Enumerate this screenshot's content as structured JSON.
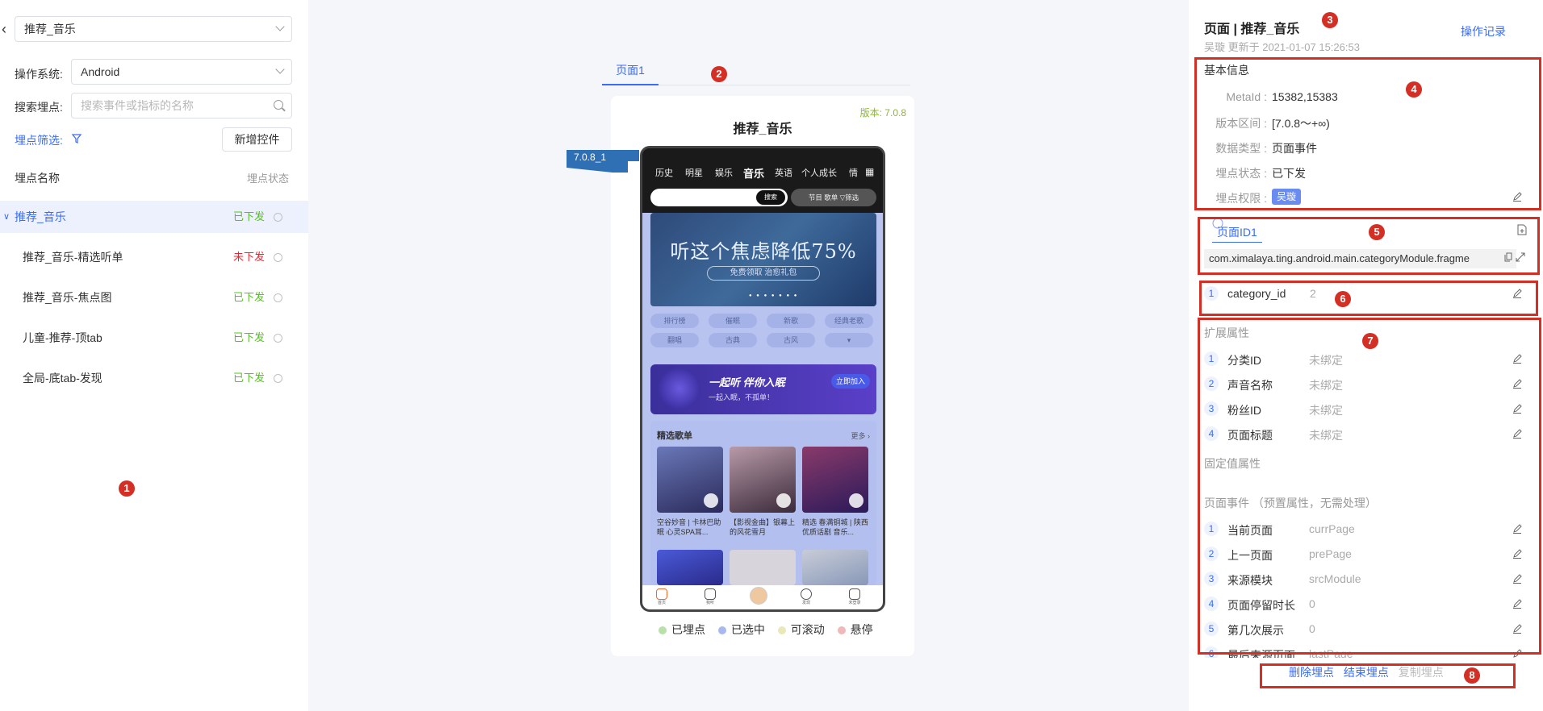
{
  "left": {
    "page_select": "推荐_音乐",
    "os_label": "操作系统:",
    "os_value": "Android",
    "search_label": "搜索埋点:",
    "search_placeholder": "搜索事件或指标的名称",
    "filter_label": "埋点筛选:",
    "add_button": "新增控件",
    "col_name": "埋点名称",
    "col_status": "埋点状态",
    "items": [
      {
        "label": "推荐_音乐",
        "status": "已下发",
        "status_type": "ok"
      },
      {
        "label": "推荐_音乐-精选听单",
        "status": "未下发",
        "status_type": "no"
      },
      {
        "label": "推荐_音乐-焦点图",
        "status": "已下发",
        "status_type": "ok"
      },
      {
        "label": "儿童-推荐-顶tab",
        "status": "已下发",
        "status_type": "ok"
      },
      {
        "label": "全局-底tab-发现",
        "status": "已下发",
        "status_type": "ok"
      }
    ]
  },
  "markers": [
    "1",
    "2",
    "3",
    "4",
    "5",
    "6",
    "7",
    "8"
  ],
  "center": {
    "tab": "页面1",
    "version": "版本: 7.0.8",
    "title": "推荐_音乐",
    "flag": "7.0.8_1",
    "phone": {
      "nav": [
        "历史",
        "明星",
        "娱乐",
        "音乐",
        "英语",
        "个人成长",
        "情"
      ],
      "search_btn": "搜索",
      "pills": "节目  歌单  ▽筛选",
      "banner": "听这个焦虑降低75%",
      "banner_sub": "免费领取 治愈礼包",
      "chips": [
        "排行榜",
        "催眠",
        "新歌",
        "经典老歌",
        "翻唱",
        "古典",
        "古风",
        "▾"
      ],
      "promo_title": "一起听 伴你入眠",
      "promo_sub": "一起入眠，不孤单！",
      "promo_btn": "立即加入",
      "list_title": "精选歌单",
      "list_more": "更多 ›",
      "captions": [
        "空谷妙音 | 卡林巴助眠 心灵SPA耳...",
        "【影视金曲】银幕上的风花雪月",
        "精选 春满铜城 | 陕西优质话剧 音乐..."
      ],
      "tabbar": [
        "首页",
        "我听",
        "",
        "发现",
        "未登录"
      ]
    },
    "legend": [
      "已埋点",
      "已选中",
      "可滚动",
      "悬停"
    ],
    "legend_colors": [
      "#b8e0a8",
      "#a8b8f0",
      "#e8e8b8",
      "#f0b8b8"
    ]
  },
  "right": {
    "title": "页面 | 推荐_音乐",
    "updated": "吴璇 更新于 2021-01-07 15:26:53",
    "log_link": "操作记录",
    "basic_title": "基本信息",
    "basic": [
      {
        "k": "MetaId :",
        "v": "15382,15383"
      },
      {
        "k": "版本区间 :",
        "v": "[7.0.8～+∞)"
      },
      {
        "k": "数据类型 :",
        "v": "页面事件"
      },
      {
        "k": "埋点状态 :",
        "v": "已下发"
      },
      {
        "k": "埋点权限 :",
        "v": "吴璇"
      }
    ],
    "page_id_tab": "页面ID1",
    "class_name": "com.ximalaya.ting.android.main.categoryModule.fragme",
    "param": {
      "num": "1",
      "name": "category_id",
      "val": "2"
    },
    "ext_title": "扩展属性",
    "ext": [
      {
        "num": "1",
        "name": "分类ID",
        "val": "未绑定"
      },
      {
        "num": "2",
        "name": "声音名称",
        "val": "未绑定"
      },
      {
        "num": "3",
        "name": "粉丝ID",
        "val": "未绑定"
      },
      {
        "num": "4",
        "name": "页面标题",
        "val": "未绑定"
      }
    ],
    "fixed_title": "固定值属性",
    "event_title": "页面事件 （预置属性，无需处理）",
    "events": [
      {
        "num": "1",
        "name": "当前页面",
        "val": "currPage"
      },
      {
        "num": "2",
        "name": "上一页面",
        "val": "prePage"
      },
      {
        "num": "3",
        "name": "来源模块",
        "val": "srcModule"
      },
      {
        "num": "4",
        "name": "页面停留时长",
        "val": "0"
      },
      {
        "num": "5",
        "name": "第几次展示",
        "val": "0"
      },
      {
        "num": "6",
        "name": "最后来源页面",
        "val": "lastPage"
      }
    ],
    "actions": [
      "删除埋点",
      "结束埋点",
      "复制埋点"
    ]
  }
}
